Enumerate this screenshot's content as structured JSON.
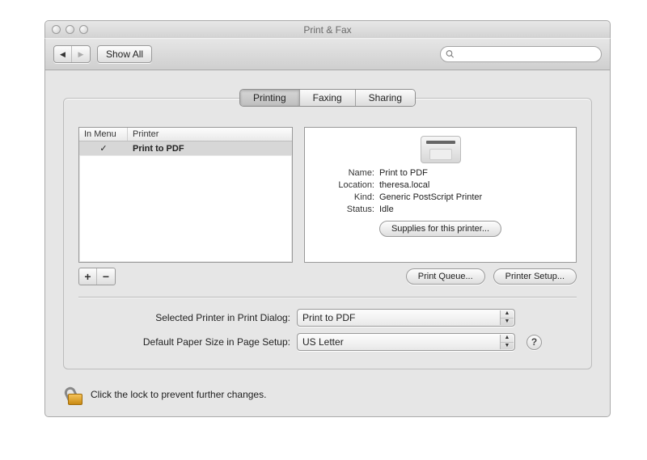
{
  "window": {
    "title": "Print & Fax"
  },
  "toolbar": {
    "show_all_label": "Show All",
    "search_placeholder": ""
  },
  "tabs": {
    "items": [
      "Printing",
      "Faxing",
      "Sharing"
    ],
    "active_index": 0
  },
  "printer_list": {
    "columns": {
      "menu": "In Menu",
      "printer": "Printer"
    },
    "rows": [
      {
        "in_menu": true,
        "name": "Print to PDF"
      }
    ]
  },
  "detail": {
    "labels": {
      "name": "Name:",
      "location": "Location:",
      "kind": "Kind:",
      "status": "Status:"
    },
    "values": {
      "name": "Print to PDF",
      "location": "theresa.local",
      "kind": "Generic PostScript Printer",
      "status": "Idle"
    },
    "supplies_button": "Supplies for this printer..."
  },
  "actions": {
    "print_queue": "Print Queue...",
    "printer_setup": "Printer Setup..."
  },
  "form": {
    "selected_printer_label": "Selected Printer in Print Dialog:",
    "selected_printer_value": "Print to PDF",
    "paper_size_label": "Default Paper Size in Page Setup:",
    "paper_size_value": "US Letter"
  },
  "lock": {
    "text": "Click the lock to prevent further changes."
  },
  "glyphs": {
    "check": "✓",
    "help": "?",
    "plus": "+",
    "minus": "−",
    "up": "▲",
    "down": "▼",
    "left": "◀",
    "right": "▶"
  }
}
